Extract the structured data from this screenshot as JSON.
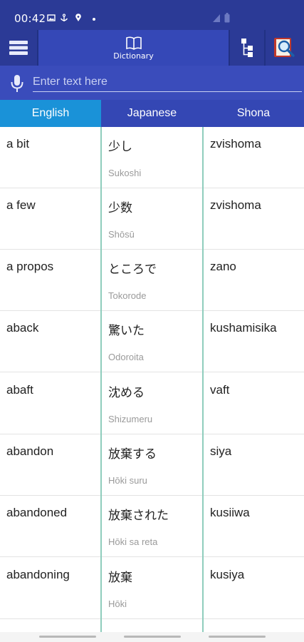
{
  "status": {
    "time": "00:42"
  },
  "toolbar": {
    "dictionary_label": "Dictionary",
    "menu_icon": "menu-icon",
    "tree_icon": "hierarchy-icon",
    "search_icon": "book-search-icon"
  },
  "search": {
    "placeholder": "Enter text here",
    "value": ""
  },
  "tabs": [
    {
      "label": "English"
    },
    {
      "label": "Japanese"
    },
    {
      "label": "Shona"
    }
  ],
  "rows": [
    {
      "english": "a bit",
      "japanese": "少し",
      "romaji": "Sukoshi",
      "shona": "zvishoma"
    },
    {
      "english": "a few",
      "japanese": "少数",
      "romaji": "Shōsū",
      "shona": "zvishoma"
    },
    {
      "english": "a propos",
      "japanese": "ところで",
      "romaji": "Tokorode",
      "shona": "zano"
    },
    {
      "english": "aback",
      "japanese": "驚いた",
      "romaji": "Odoroita",
      "shona": "kushamisika"
    },
    {
      "english": "abaft",
      "japanese": "沈める",
      "romaji": "Shizumeru",
      "shona": "vaft"
    },
    {
      "english": "abandon",
      "japanese": "放棄する",
      "romaji": "Hōki suru",
      "shona": "siya"
    },
    {
      "english": "abandoned",
      "japanese": "放棄された",
      "romaji": "Hōki sa reta",
      "shona": "kusiiwa"
    },
    {
      "english": "abandoning",
      "japanese": "放棄",
      "romaji": "Hōki",
      "shona": "kusiya"
    }
  ],
  "colors": {
    "primary": "#2b3a96",
    "tab_active": "#1a92d8",
    "divider": "#8fcdbd"
  }
}
